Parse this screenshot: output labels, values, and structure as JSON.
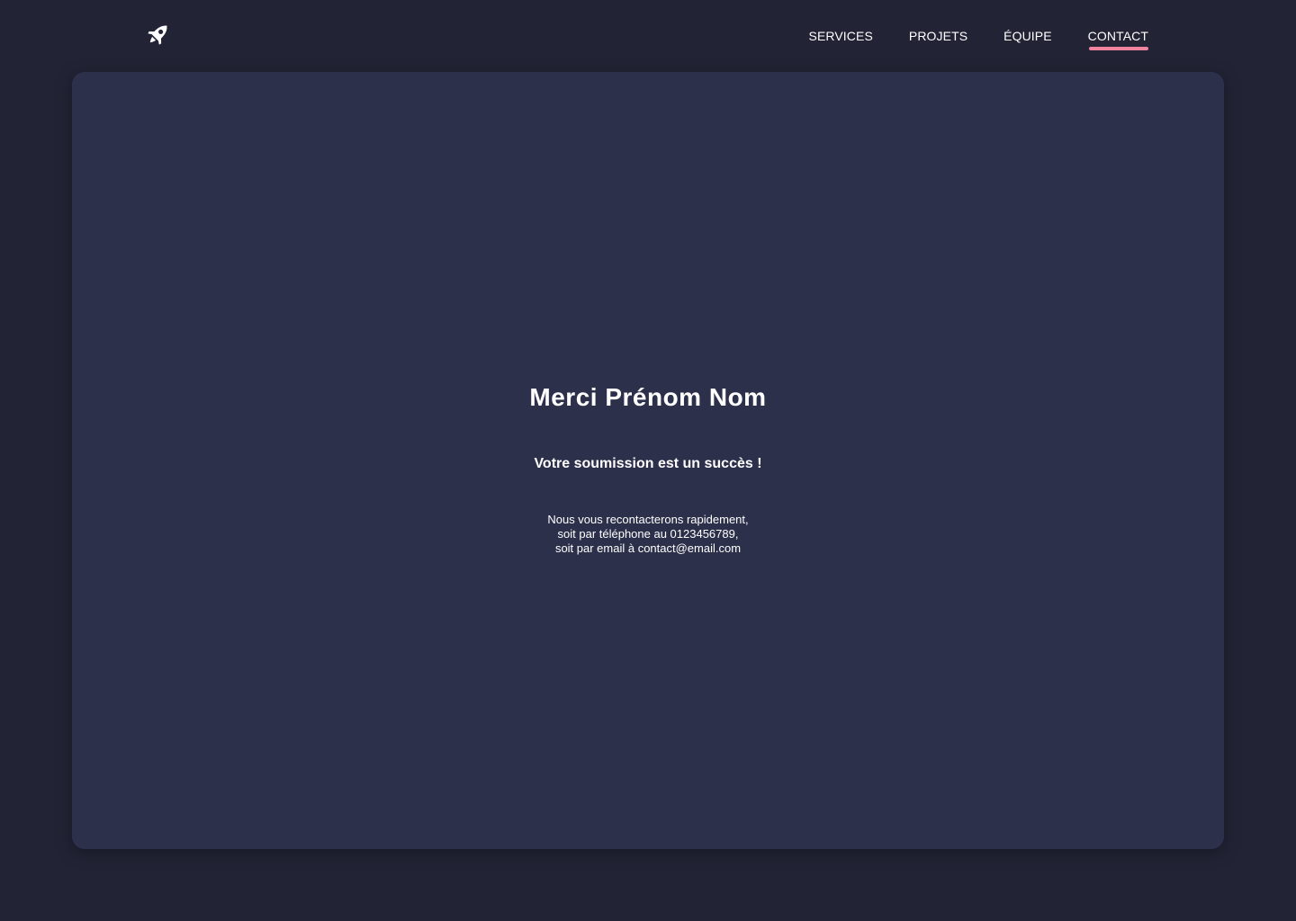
{
  "header": {
    "logo_icon": "rocket-icon",
    "nav": [
      {
        "label": "SERVICES",
        "active": false
      },
      {
        "label": "PROJETS",
        "active": false
      },
      {
        "label": "ÉQUIPE",
        "active": false
      },
      {
        "label": "CONTACT",
        "active": true
      }
    ],
    "active_underline_color": "#f0839f"
  },
  "main": {
    "title": "Merci Prénom Nom",
    "subtitle": "Votre soumission est un succès !",
    "message_lines": [
      "Nous vous recontacterons rapidement,",
      "soit par téléphone au 0123456789,",
      "soit par email à contact@email.com"
    ]
  },
  "colors": {
    "page_background": "#222436",
    "card_background": "#2d304b",
    "text": "#ffffff",
    "accent": "#f0839f"
  }
}
